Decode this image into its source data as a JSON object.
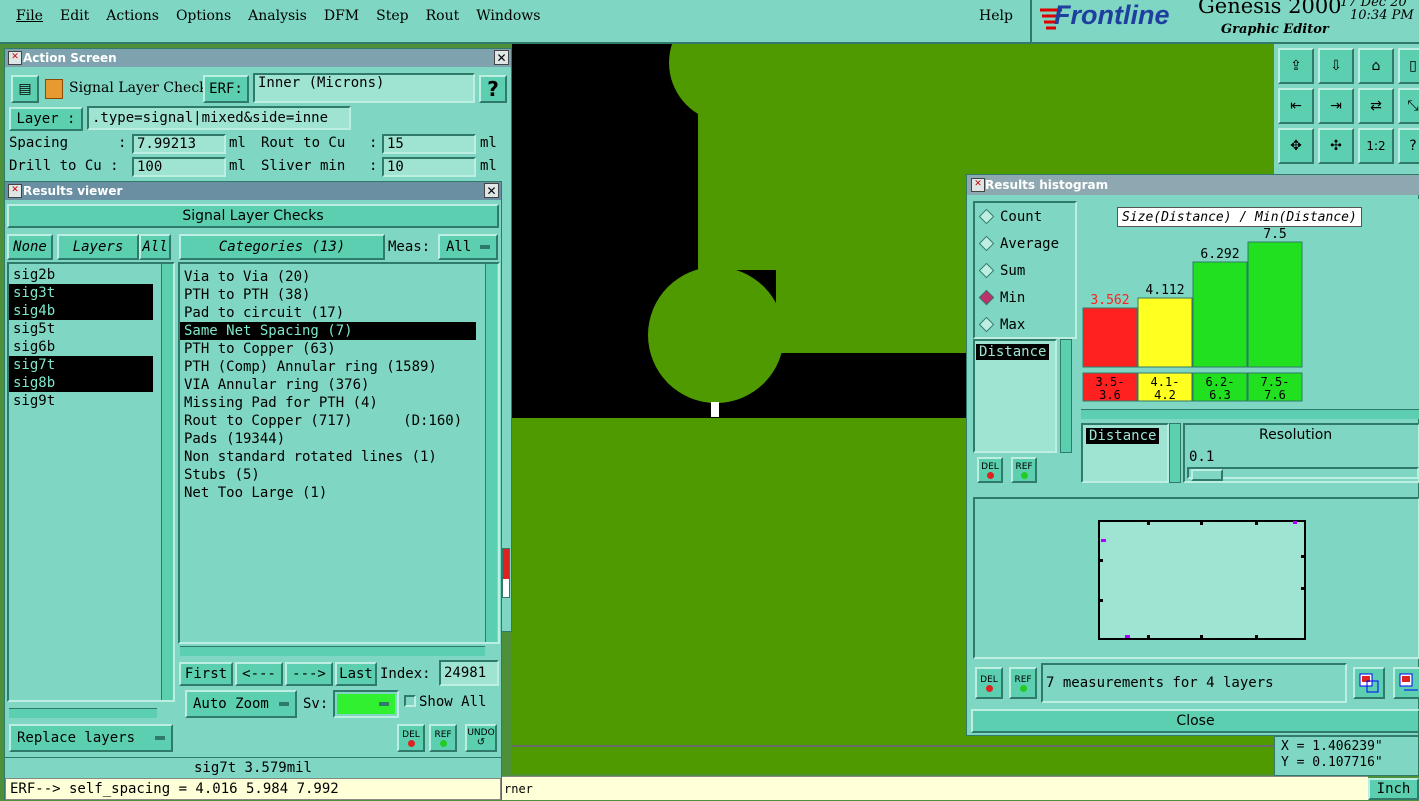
{
  "menubar": {
    "items": [
      "File",
      "Edit",
      "Actions",
      "Options",
      "Analysis",
      "DFM",
      "Step",
      "Rout",
      "Windows"
    ],
    "help": "Help",
    "brand": "Frontline",
    "product": "Genesis 2000",
    "subtitle": "Graphic Editor",
    "date": "17 Dec 20",
    "time": "10:34 PM"
  },
  "action_screen": {
    "title": "Action Screen",
    "check_name": "Signal Layer Checks",
    "erf_label": "ERF:",
    "erf_value": "Inner (Microns)",
    "help": "?",
    "layer_label": "Layer :",
    "layer_value": ".type=signal|mixed&side=inne",
    "spacing_label": "Spacing",
    "spacing_value": "7.99213",
    "spacing_unit": "ml",
    "rout_label": "Rout to Cu",
    "rout_value": "15",
    "rout_unit": "ml",
    "drill_label": "Drill to Cu :",
    "drill_value": "100",
    "drill_unit": "ml",
    "sliver_label": "Sliver min",
    "sliver_value": "10",
    "sliver_unit": "ml",
    "colon": ":"
  },
  "results_viewer": {
    "title": "Results viewer",
    "header": "Signal Layer Checks",
    "none": "None",
    "layers": "Layers",
    "all": "All",
    "categories_label": "Categories (13)",
    "meas_label": "Meas:",
    "meas_value": "All",
    "layer_list": [
      {
        "name": "sig2b",
        "selected": false
      },
      {
        "name": "sig3t",
        "selected": true
      },
      {
        "name": "sig4b",
        "selected": true
      },
      {
        "name": "sig5t",
        "selected": false
      },
      {
        "name": "sig6b",
        "selected": false
      },
      {
        "name": "sig7t",
        "selected": true
      },
      {
        "name": "sig8b",
        "selected": true
      },
      {
        "name": "sig9t",
        "selected": false
      }
    ],
    "categories": [
      {
        "name": "Via to Via (20)",
        "selected": false
      },
      {
        "name": "PTH to PTH (38)",
        "selected": false
      },
      {
        "name": "Pad to circuit (17)",
        "selected": false
      },
      {
        "name": "Same Net Spacing (7)",
        "selected": true
      },
      {
        "name": "PTH to Copper (63)",
        "selected": false
      },
      {
        "name": "PTH (Comp) Annular ring (1589)",
        "selected": false
      },
      {
        "name": "VIA Annular ring (376)",
        "selected": false
      },
      {
        "name": "Missing Pad for PTH (4)",
        "selected": false
      },
      {
        "name": "Rout to Copper (717)      (D:160)",
        "selected": false
      },
      {
        "name": "Pads (19344)",
        "selected": false
      },
      {
        "name": "Non standard rotated lines (1)",
        "selected": false
      },
      {
        "name": "Stubs (5)",
        "selected": false
      },
      {
        "name": "Net Too Large (1)",
        "selected": false
      }
    ],
    "first": "First",
    "prev": "<---",
    "next": "--->",
    "last": "Last",
    "index_label": "Index:",
    "index_value": "24981",
    "auto_zoom": "Auto Zoom",
    "sv_label": "Sv:",
    "show_all": "Show All",
    "replace_layers": "Replace layers",
    "del": "DEL",
    "ref": "REF",
    "undo": "UNDO",
    "status": "sig7t 3.579mil",
    "erf_line": "ERF--> self_spacing = 4.016 5.984 7.992"
  },
  "histogram": {
    "title": "Results histogram",
    "modes": [
      {
        "label": "Count",
        "selected": false
      },
      {
        "label": "Average",
        "selected": false
      },
      {
        "label": "Sum",
        "selected": false
      },
      {
        "label": "Min",
        "selected": true
      },
      {
        "label": "Max",
        "selected": false
      }
    ],
    "chart_title": "Size(Distance) / Min(Distance)",
    "list_item": "Distance",
    "bins": [
      {
        "value": 3.562,
        "label": "3.562",
        "range1": "3.5-",
        "range2": "3.6",
        "color": "#ff2020",
        "label_color": "#ff2020"
      },
      {
        "value": 4.112,
        "label": "4.112",
        "range1": "4.1-",
        "range2": "4.2",
        "color": "#ffff20",
        "label_color": "#000000"
      },
      {
        "value": 6.292,
        "label": "6.292",
        "range1": "6.2-",
        "range2": "6.3",
        "color": "#20e020",
        "label_color": "#000000"
      },
      {
        "value": 7.5,
        "label": "7.5",
        "range1": "7.5-",
        "range2": "7.6",
        "color": "#20e020",
        "label_color": "#000000"
      }
    ],
    "distance_label": "Distance",
    "resolution_label": "Resolution",
    "resolution_value": "0.1",
    "measurements_text": "7 measurements for 4 layers",
    "close": "Close",
    "del": "DEL",
    "ref": "REF"
  },
  "coords": {
    "x": "X = 1.406239\"",
    "y": "Y = 0.107716\"",
    "unit": "Inch"
  },
  "bottom_status": "rner"
}
